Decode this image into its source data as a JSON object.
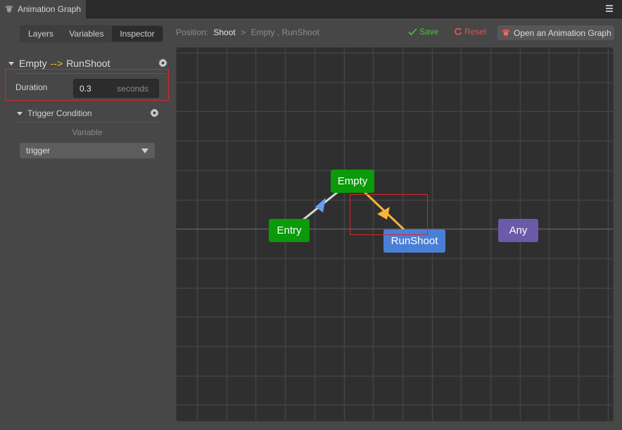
{
  "window": {
    "tab_title": "Animation Graph",
    "menu_icon": "hamburger-menu-icon"
  },
  "panel_tabs": [
    {
      "label": "Layers",
      "active": false
    },
    {
      "label": "Variables",
      "active": false
    },
    {
      "label": "Inspector",
      "active": true
    }
  ],
  "breadcrumb": {
    "prefix": "Position:",
    "current": "Shoot",
    "separator": ">",
    "path": "Empty , RunShoot"
  },
  "toolbar": {
    "save_label": "Save",
    "reset_label": "Reset",
    "open_label": "Open an Animation Graph",
    "save_color": "#45c83a",
    "reset_color": "#e05252"
  },
  "inspector": {
    "transition": {
      "from": "Empty",
      "arrow": "-->",
      "to": "RunShoot"
    },
    "duration": {
      "label": "Duration",
      "value": "0.3",
      "unit": "seconds"
    },
    "trigger_condition": {
      "title": "Trigger Condition",
      "variable_label": "Variable",
      "selected": "trigger"
    }
  },
  "graph": {
    "nodes": [
      {
        "id": "entry",
        "label": "Entry",
        "color": "#0a9a0a"
      },
      {
        "id": "empty",
        "label": "Empty",
        "color": "#0a9a0a"
      },
      {
        "id": "runshoot",
        "label": "RunShoot",
        "color": "#4a7fd8"
      },
      {
        "id": "any",
        "label": "Any",
        "color": "#6a5aa8"
      }
    ],
    "transitions": [
      {
        "from": "Entry",
        "to": "Empty",
        "color": "#d8d8d8",
        "arrow_color": "#6a9cf0",
        "selected": false
      },
      {
        "from": "Empty",
        "to": "RunShoot",
        "color": "#f5b43a",
        "arrow_color": "#f5b43a",
        "selected": true
      }
    ]
  }
}
